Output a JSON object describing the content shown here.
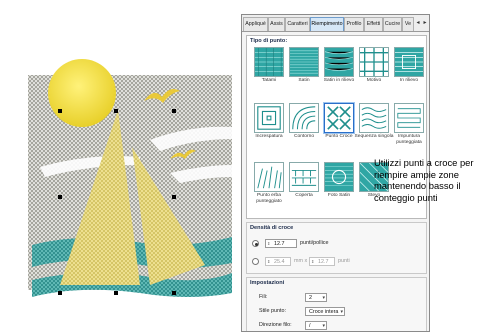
{
  "tabs": {
    "items": [
      "Appliqué",
      "Assis",
      "Caratteri",
      "Riempimento",
      "Profilo",
      "Effetti",
      "Cucire",
      "Ve"
    ],
    "active": "Riempimento"
  },
  "stitch_types": {
    "title": "Tipo di punto:",
    "items": [
      "Tatami",
      "Satin",
      "Satin in rilievo",
      "Motivo",
      "In rilievo",
      "Increspatura",
      "Contorno",
      "Punto Croce",
      "Sequenza singola",
      "Impuntura punteggiata",
      "Punto erba punteggiato",
      "Coperta",
      "Foto Satin",
      "Stevo"
    ],
    "selected": "Punto Croce"
  },
  "density": {
    "title": "Densità di croce",
    "row1_value": "12.7",
    "row1_unit": "punti/pollice",
    "row2_value1": "25.4",
    "row2_mid": "mm x",
    "row2_value2": "12.7",
    "row2_unit": "punti"
  },
  "settings": {
    "title": "Impostazioni",
    "fili_label": "Fili:",
    "fili_value": "2",
    "stile_label": "Stile punto:",
    "stile_value": "Croce intera",
    "direzione_label": "Direzione filo:",
    "direzione_value": "/"
  },
  "callout": {
    "text": "Utilizzi punti a croce per riempire ampie zone mantenendo basso il conteggio punti"
  },
  "colors": {
    "sun": "#f2e045",
    "sail": "#f0e08a",
    "water": "#4fb4b2",
    "stitch_swatch": "#2fa6a4",
    "panel_bg": "#f4f4f4",
    "tab_active": "#d6e7f7"
  }
}
